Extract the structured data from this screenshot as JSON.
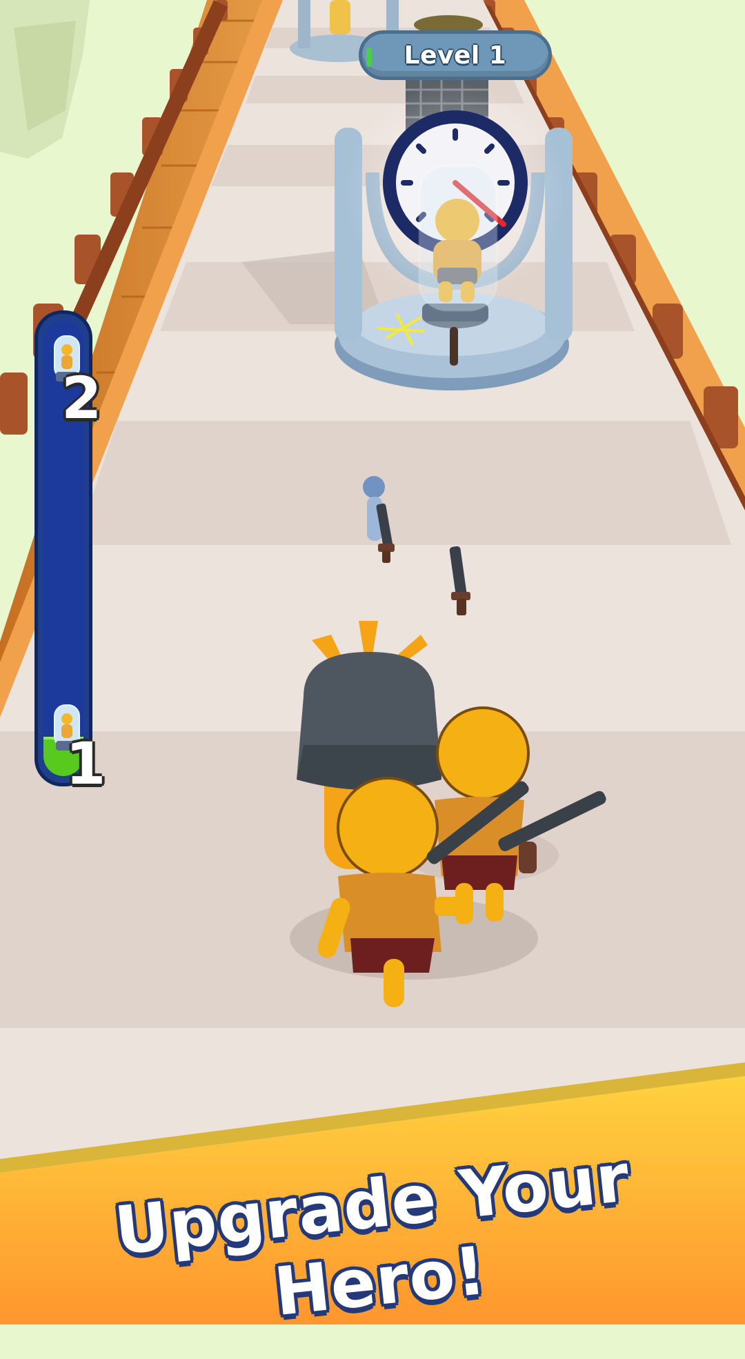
{
  "hud": {
    "level_label": "Level 1",
    "progress": {
      "milestone_top": "2",
      "milestone_bottom": "1",
      "fill_fraction": 0.08
    }
  },
  "banner": {
    "text": "Upgrade Your Hero!"
  },
  "colors": {
    "sky": "#e9f7cf",
    "track": "#ede3dd",
    "track_stripe": "#e0d3cc",
    "wood": "#d98a34",
    "fence": "#a9532a",
    "hero": "#f5b014",
    "banner_top": "#ffd23f",
    "banner_bottom": "#ff9a2e",
    "progress_bg": "#1f3e8c",
    "progress_fill": "#58c91f"
  }
}
